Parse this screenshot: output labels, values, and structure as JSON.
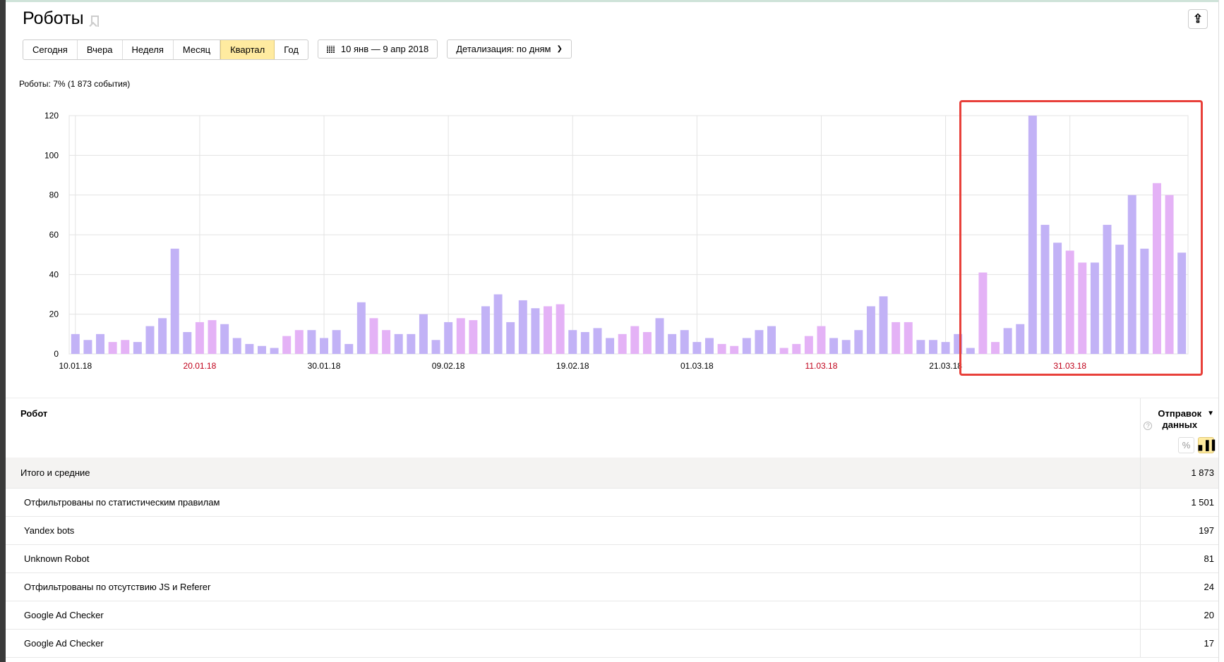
{
  "header": {
    "title": "Роботы",
    "export_icon": "export-icon"
  },
  "periods": [
    {
      "label": "Сегодня"
    },
    {
      "label": "Вчера"
    },
    {
      "label": "Неделя"
    },
    {
      "label": "Месяц"
    },
    {
      "label": "Квартал",
      "active": true
    },
    {
      "label": "Год"
    }
  ],
  "date_range": "10 янв — 9 апр 2018",
  "detail": "Детализация: по дням",
  "summary": "Роботы: 7% (1 873 события)",
  "colors": {
    "weekday": "#c2b2f6",
    "weekend": "#e4b2f6",
    "highlight": "#e8403a"
  },
  "chart_data": {
    "type": "bar",
    "title": "",
    "xlabel": "",
    "ylabel": "",
    "ylim": [
      0,
      120
    ],
    "yticks": [
      0,
      20,
      40,
      60,
      80,
      100,
      120
    ],
    "start_date": "10.01.18",
    "xticks": [
      {
        "index": 0,
        "label": "10.01.18",
        "holiday": false
      },
      {
        "index": 10,
        "label": "20.01.18",
        "holiday": true
      },
      {
        "index": 20,
        "label": "30.01.18",
        "holiday": false
      },
      {
        "index": 30,
        "label": "09.02.18",
        "holiday": false
      },
      {
        "index": 40,
        "label": "19.02.18",
        "holiday": false
      },
      {
        "index": 50,
        "label": "01.03.18",
        "holiday": false
      },
      {
        "index": 60,
        "label": "11.03.18",
        "holiday": true
      },
      {
        "index": 70,
        "label": "21.03.18",
        "holiday": false
      },
      {
        "index": 80,
        "label": "31.03.18",
        "holiday": true
      }
    ],
    "values": [
      10,
      7,
      10,
      6,
      7,
      6,
      14,
      18,
      53,
      11,
      16,
      17,
      15,
      8,
      5,
      4,
      3,
      9,
      12,
      12,
      8,
      12,
      5,
      26,
      18,
      12,
      10,
      10,
      20,
      7,
      16,
      18,
      17,
      24,
      30,
      16,
      27,
      23,
      24,
      25,
      12,
      11,
      13,
      8,
      10,
      14,
      11,
      18,
      10,
      12,
      6,
      8,
      5,
      4,
      8,
      12,
      14,
      3,
      5,
      9,
      14,
      8,
      7,
      12,
      24,
      29,
      16,
      16,
      7,
      7,
      6,
      10,
      3,
      41,
      6,
      13,
      15,
      120,
      65,
      56,
      52,
      46,
      46,
      65,
      55,
      80,
      53,
      86,
      80,
      51
    ],
    "holiday_indices": [
      3,
      4,
      10,
      11,
      17,
      18,
      24,
      25,
      31,
      32,
      38,
      39,
      44,
      45,
      46,
      52,
      53,
      57,
      58,
      59,
      60,
      66,
      67,
      73,
      74,
      80,
      81,
      87,
      88
    ],
    "highlighted_range": [
      "23.03.18",
      "09.04.18"
    ]
  },
  "table": {
    "col_robot": "Робот",
    "col_metric": "Отправок данных",
    "pct_toggle": "%",
    "total": {
      "name": "Итого и средние",
      "value": "1 873"
    },
    "rows": [
      {
        "name": "Отфильтрованы по статистическим правилам",
        "value": "1 501"
      },
      {
        "name": "Yandex bots",
        "value": "197"
      },
      {
        "name": "Unknown Robot",
        "value": "81"
      },
      {
        "name": "Отфильтрованы по отсутствию JS и Referer",
        "value": "24"
      },
      {
        "name": "Google Ad Checker",
        "value": "20"
      },
      {
        "name": "Google Ad Checker",
        "value": "17"
      }
    ]
  }
}
